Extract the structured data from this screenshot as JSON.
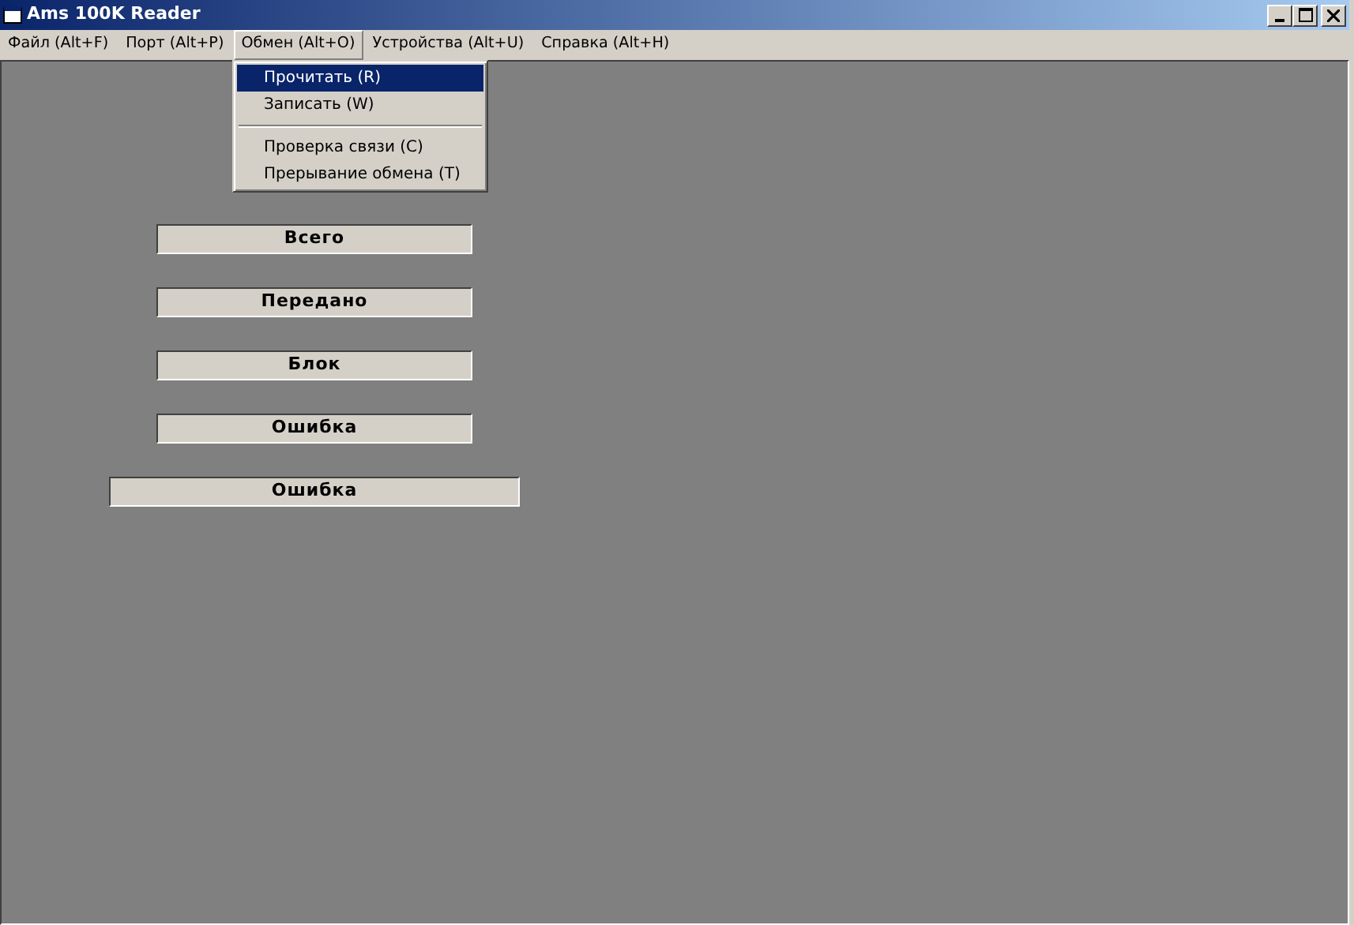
{
  "window": {
    "title": "Ams 100K Reader"
  },
  "menubar": [
    {
      "label": "Файл (Alt+F)",
      "selected": false
    },
    {
      "label": "Порт (Alt+P)",
      "selected": false
    },
    {
      "label": "Обмен (Alt+O)",
      "selected": true
    },
    {
      "label": "Устройства (Alt+U)",
      "selected": false
    },
    {
      "label": "Справка (Alt+H)",
      "selected": false
    }
  ],
  "dropdown": [
    {
      "kind": "item",
      "label": "Прочитать (R)",
      "selected": true
    },
    {
      "kind": "item",
      "label": "Записать (W)",
      "selected": false
    },
    {
      "kind": "separator"
    },
    {
      "kind": "item",
      "label": "Проверка связи (C)",
      "selected": false
    },
    {
      "kind": "item",
      "label": "Прерывание обмена (T)",
      "selected": false
    }
  ],
  "panels": [
    {
      "kind": "narrow",
      "label": "Всего"
    },
    {
      "kind": "narrow",
      "label": "Передано"
    },
    {
      "kind": "narrow",
      "label": "Блок"
    },
    {
      "kind": "narrow",
      "label": "Ошибка"
    },
    {
      "kind": "wide",
      "label": "Ошибка"
    }
  ]
}
